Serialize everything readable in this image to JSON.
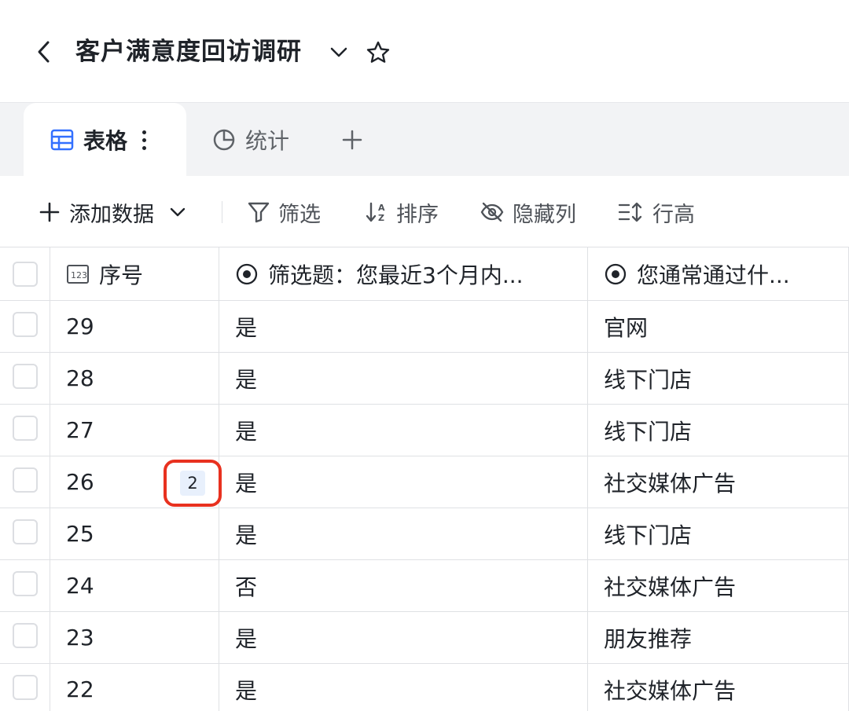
{
  "header": {
    "title": "客户满意度回访调研",
    "back_icon": "chevron-left-icon",
    "dropdown_icon": "chevron-down-icon",
    "favorite_icon": "star-icon"
  },
  "tabs": [
    {
      "label": "表格",
      "icon": "table-icon",
      "active": true
    },
    {
      "label": "统计",
      "icon": "pie-chart-icon",
      "active": false
    }
  ],
  "toolbar": {
    "add_data": "添加数据",
    "filter": "筛选",
    "sort": "排序",
    "hide_columns": "隐藏列",
    "row_height": "行高"
  },
  "columns": {
    "seq": "序号",
    "a": "筛选题：您最近3个月内...",
    "b": "您通常通过什..."
  },
  "rows": [
    {
      "seq": "29",
      "a": "是",
      "b": "官网"
    },
    {
      "seq": "28",
      "a": "是",
      "b": "线下门店"
    },
    {
      "seq": "27",
      "a": "是",
      "b": "线下门店"
    },
    {
      "seq": "26",
      "a": "是",
      "b": "社交媒体广告",
      "badge": "2"
    },
    {
      "seq": "25",
      "a": "是",
      "b": "线下门店"
    },
    {
      "seq": "24",
      "a": "否",
      "b": "社交媒体广告"
    },
    {
      "seq": "23",
      "a": "是",
      "b": "朋友推荐"
    },
    {
      "seq": "22",
      "a": "是",
      "b": "社交媒体广告"
    }
  ],
  "colors": {
    "accent": "#3370ff",
    "highlight": "#e8311f",
    "badge_bg": "#e8f0fc"
  }
}
